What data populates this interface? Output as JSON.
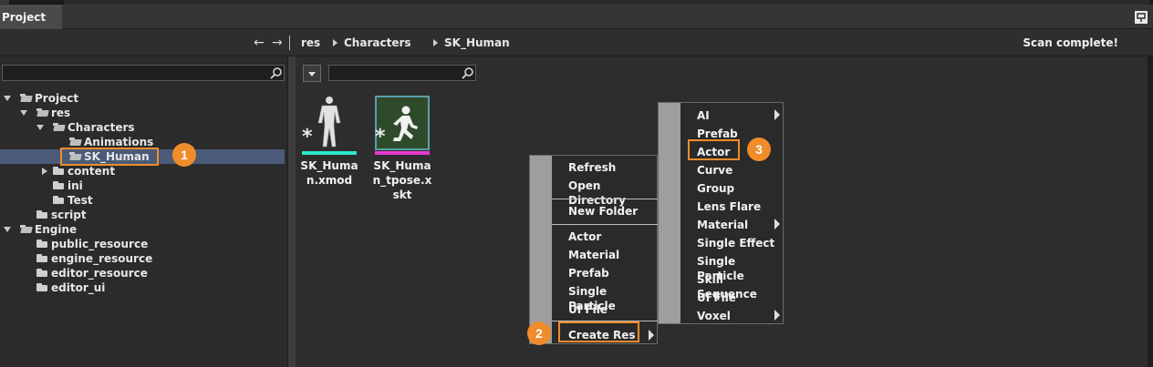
{
  "window": {
    "tab_title": "Project",
    "pin_icon": "pin-icon"
  },
  "pathbar": {
    "back_glyph": "←",
    "forward_glyph": "→",
    "crumbs": [
      "res",
      "Characters",
      "SK_Human"
    ],
    "status": "Scan complete!"
  },
  "tree": {
    "nodes": [
      {
        "label": "Project"
      },
      {
        "label": "res"
      },
      {
        "label": "Characters"
      },
      {
        "label": "Animations"
      },
      {
        "label": "SK_Human"
      },
      {
        "label": "content"
      },
      {
        "label": "ini"
      },
      {
        "label": "Test"
      },
      {
        "label": "script"
      },
      {
        "label": "Engine"
      },
      {
        "label": "public_resource"
      },
      {
        "label": "engine_resource"
      },
      {
        "label": "editor_resource"
      },
      {
        "label": "editor_ui"
      }
    ],
    "selected": "SK_Human"
  },
  "assets": [
    {
      "name_line1": "SK_Huma",
      "name_line2": "n.xmod",
      "name_line3": "",
      "bar_color": "#2ee6c8",
      "star": "*"
    },
    {
      "name_line1": "SK_Huma",
      "name_line2": "n_tpose.x",
      "name_line3": "skt",
      "bar_color": "#e63ad0",
      "star": "*"
    }
  ],
  "context_menu": {
    "items": [
      "Refresh",
      "Open Directory",
      "New Folder",
      "Actor",
      "Material",
      "Prefab",
      "Single Particle",
      "UI File",
      "Create Res"
    ]
  },
  "sub_menu": {
    "items": [
      "AI",
      "Prefab",
      "Actor",
      "Curve",
      "Group",
      "Lens Flare",
      "Material",
      "Single Effect",
      "Single Particle",
      "Skill Sequence",
      "UI File",
      "Voxel"
    ]
  },
  "callouts": [
    "1",
    "2",
    "3"
  ],
  "colors": {
    "accent": "#f08c2a",
    "selection": "#4a5a78",
    "xmod_bar": "#2ee6c8",
    "xskt_bar": "#e63ad0"
  }
}
